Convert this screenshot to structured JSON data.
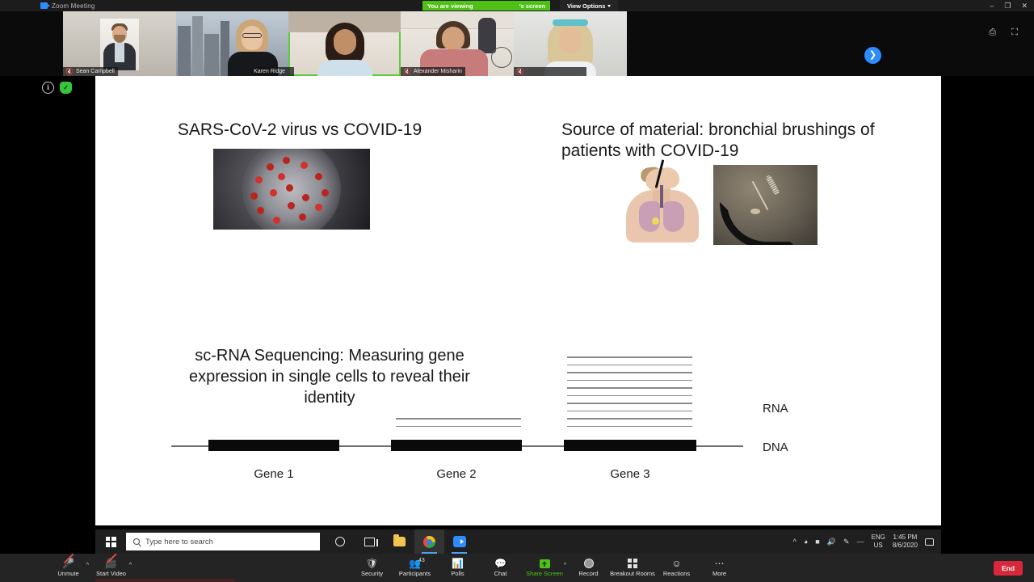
{
  "window": {
    "app_title": "Zoom Meeting",
    "logo_icon": "zoom-logo-icon",
    "minimize_label": "–",
    "restore_label": "❐",
    "close_label": "✕"
  },
  "viewing_banner": {
    "prefix": "You are viewing",
    "presenter_name": "",
    "suffix": "'s screen",
    "background_color": "#4fc116",
    "view_options_label": "View Options",
    "chevron_icon": "chevron-down-icon"
  },
  "video_controls": {
    "minimize_video_icon": "minimize-video-icon",
    "fullscreen_icon": "fullscreen-icon",
    "next_page_icon": "chevron-right-icon"
  },
  "filmstrip": {
    "participants": [
      {
        "name": "Sean Campbell",
        "muted": true,
        "active_speaker": false
      },
      {
        "name": "Karen Ridge",
        "muted": false,
        "active_speaker": false
      },
      {
        "name": "",
        "muted": false,
        "active_speaker": true
      },
      {
        "name": "Alexander Misharin",
        "muted": true,
        "active_speaker": false
      },
      {
        "name": "",
        "muted": true,
        "active_speaker": false
      }
    ],
    "mic_muted_icon": "microphone-muted-icon"
  },
  "meeting_meta": {
    "info_icon": "info-icon",
    "encryption_icon": "encryption-shield-icon",
    "cursor_icon": "presenter-cursor-icon"
  },
  "slide": {
    "title_left": "SARS-CoV-2 virus vs COVID-19",
    "title_right": "Source of material: bronchial brushings of patients with COVID-19",
    "title_scrna": "sc-RNA Sequencing: Measuring gene expression in single cells to reveal their identity",
    "images": {
      "virus": "coronavirus-particle-image",
      "lung": "bronchoscopy-anatomy-illustration",
      "brush": "bronchial-brush-photo"
    },
    "chart_data": {
      "type": "bar",
      "title": "sc-RNA Sequencing: Measuring gene expression in single cells to reveal their identity",
      "categories": [
        "Gene 1",
        "Gene 2",
        "Gene 3"
      ],
      "values": [
        0,
        2,
        10
      ],
      "value_unit": "RNA transcript lines",
      "row_labels": [
        "RNA",
        "DNA"
      ],
      "xlabel": "",
      "ylabel": "RNA",
      "ylim": [
        0,
        10
      ],
      "grid": false,
      "legend": "none",
      "notes": "Horizontal DNA axis with three black gene bodies; stacked grey horizontal lines above each gene represent RNA transcripts expressed from that gene."
    }
  },
  "taskbar": {
    "start_icon": "windows-start-icon",
    "search_placeholder": "Type here to search",
    "search_icon": "search-icon",
    "items": [
      {
        "name": "cortana-icon",
        "label": "Cortana"
      },
      {
        "name": "task-view-icon",
        "label": "Task View"
      },
      {
        "name": "file-explorer-icon",
        "label": "File Explorer"
      },
      {
        "name": "google-chrome-icon",
        "label": "Google Chrome"
      },
      {
        "name": "zoom-app-icon",
        "label": "Zoom"
      }
    ],
    "tray": {
      "overflow_icon": "show-hidden-icons-icon",
      "network_icon": "wifi-icon",
      "battery_icon": "battery-icon",
      "volume_icon": "volume-icon",
      "pen_icon": "windows-ink-icon",
      "keyboard_icon": "touch-keyboard-icon",
      "language_line1": "ENG",
      "language_line2": "US",
      "time": "1:45 PM",
      "date": "8/6/2020",
      "notifications_icon": "action-center-icon"
    }
  },
  "zoom_toolbar": {
    "left": [
      {
        "label": "Unmute",
        "icon": "microphone-muted-icon",
        "has_caret": true
      },
      {
        "label": "Start Video",
        "icon": "camera-off-icon",
        "has_caret": true
      }
    ],
    "center": [
      {
        "label": "Security",
        "icon": "shield-icon",
        "badge": ""
      },
      {
        "label": "Participants",
        "icon": "participants-icon",
        "badge": "43"
      },
      {
        "label": "Polls",
        "icon": "polls-bar-chart-icon",
        "badge": ""
      },
      {
        "label": "Chat",
        "icon": "chat-bubble-icon",
        "badge": ""
      },
      {
        "label": "Share Screen",
        "icon": "share-screen-icon",
        "badge": "",
        "has_caret": true,
        "highlight_color": "#4fc116"
      },
      {
        "label": "Record",
        "icon": "record-icon",
        "badge": ""
      },
      {
        "label": "Breakout Rooms",
        "icon": "breakout-rooms-icon",
        "badge": ""
      },
      {
        "label": "Reactions",
        "icon": "reactions-icon",
        "badge": ""
      },
      {
        "label": "More",
        "icon": "more-ellipsis-icon",
        "badge": ""
      }
    ],
    "end_label": "End",
    "end_color": "#d8293c"
  }
}
